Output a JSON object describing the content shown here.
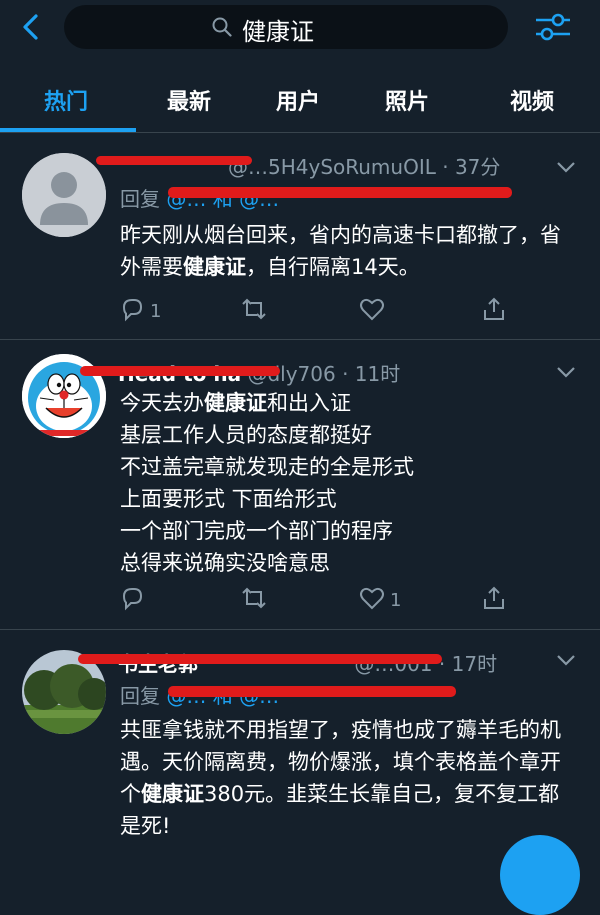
{
  "search": {
    "query": "健康证"
  },
  "tabs": [
    {
      "label": "热门"
    },
    {
      "label": "最新"
    },
    {
      "label": "用户"
    },
    {
      "label": "照片"
    },
    {
      "label": "视频"
    }
  ],
  "tweets": [
    {
      "handle": "@…5H4ySoRumuOIL",
      "sep": "·",
      "time": "37分",
      "reply_prefix": "回复",
      "reply_handles": "@… 和 @…",
      "body_before": "昨天刚从烟台回来，省内的高速卡口都撤了，省外需要",
      "highlight": "健康证",
      "body_after": "，自行隔离14天。",
      "reply_count": "1",
      "like_count": ""
    },
    {
      "name": "Head to ha",
      "handle": "@dly706",
      "sep": "·",
      "time": "11时",
      "body_lines": [
        {
          "before": "今天去办",
          "highlight": "健康证",
          "after": "和出入证"
        },
        {
          "before": "基层工作人员的态度都挺好",
          "highlight": "",
          "after": ""
        },
        {
          "before": "不过盖完章就发现走的全是形式",
          "highlight": "",
          "after": ""
        },
        {
          "before": "上面要形式 下面给形式",
          "highlight": "",
          "after": ""
        },
        {
          "before": "一个部门完成一个部门的程序",
          "highlight": "",
          "after": ""
        },
        {
          "before": "总得来说确实没啥意思",
          "highlight": "",
          "after": ""
        }
      ],
      "reply_count": "",
      "like_count": "1"
    },
    {
      "name": "书生老郭",
      "handle": "@…001",
      "sep": "·",
      "time": "17时",
      "reply_prefix": "回复",
      "reply_handles": "@… 和 @…",
      "body_before": "共匪拿钱就不用指望了，疫情也成了薅羊毛的机遇。天价隔离费，物价爆涨，填个表格盖个章开个",
      "highlight": "健康证",
      "body_after": "380元。韭菜生长靠自己，复不复工都是死!"
    }
  ],
  "colors": {
    "accent": "#1da1f2",
    "background": "#15202b",
    "muted": "#8899a6",
    "redaction": "#e01b1b"
  }
}
